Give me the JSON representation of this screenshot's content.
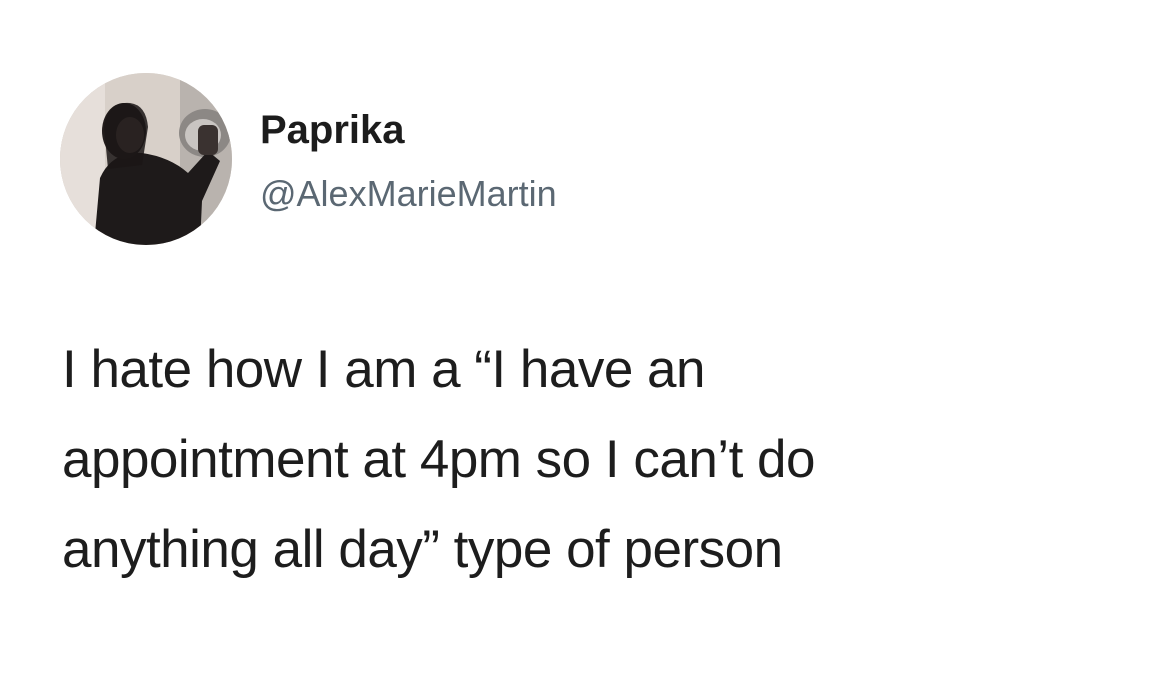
{
  "tweet": {
    "avatar_icon": "profile-photo",
    "display_name": "Paprika",
    "handle": "@AlexMarieMartin",
    "text_lines": [
      "I hate how I am a “I have an",
      "appointment at 4pm so I can’t do",
      "anything all day” type of person"
    ]
  },
  "colors": {
    "background": "#ffffff",
    "text": "#1d1d1d",
    "handle": "#5b6873"
  }
}
